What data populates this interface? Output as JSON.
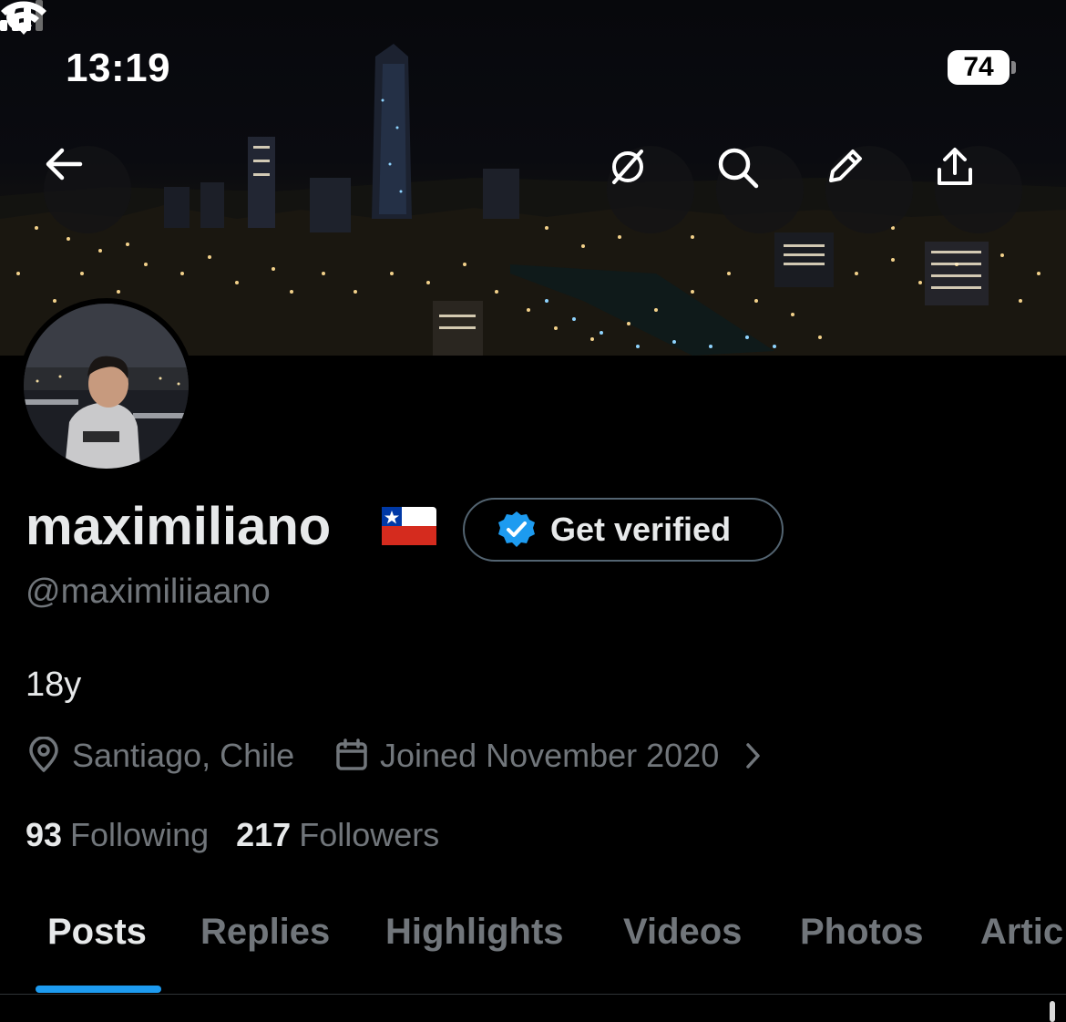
{
  "status_bar": {
    "time": "13:19",
    "battery": "74",
    "icons": [
      "moon-icon",
      "cellular-signal-icon",
      "wifi-icon",
      "battery-icon"
    ]
  },
  "banner_actions": {
    "back": "back-arrow-icon",
    "grok": "grok-icon",
    "search": "search-icon",
    "edit": "pencil-icon",
    "share": "share-icon"
  },
  "profile": {
    "display_name": "maximiliano",
    "flag": "chile-flag",
    "verify_button": "Get verified",
    "handle": "@maximiliiaano",
    "bio": "18y",
    "location": "Santiago, Chile",
    "joined": "Joined November 2020",
    "following_count": "93",
    "following_label": "Following",
    "followers_count": "217",
    "followers_label": "Followers"
  },
  "tabs": [
    {
      "label": "Posts",
      "active": true
    },
    {
      "label": "Replies",
      "active": false
    },
    {
      "label": "Highlights",
      "active": false
    },
    {
      "label": "Videos",
      "active": false
    },
    {
      "label": "Photos",
      "active": false
    },
    {
      "label": "Artic",
      "active": false
    }
  ],
  "colors": {
    "background": "#000000",
    "primary_text": "#e7e9ea",
    "secondary_text": "#71767b",
    "accent": "#1d9bf0",
    "border": "#2f3336"
  }
}
